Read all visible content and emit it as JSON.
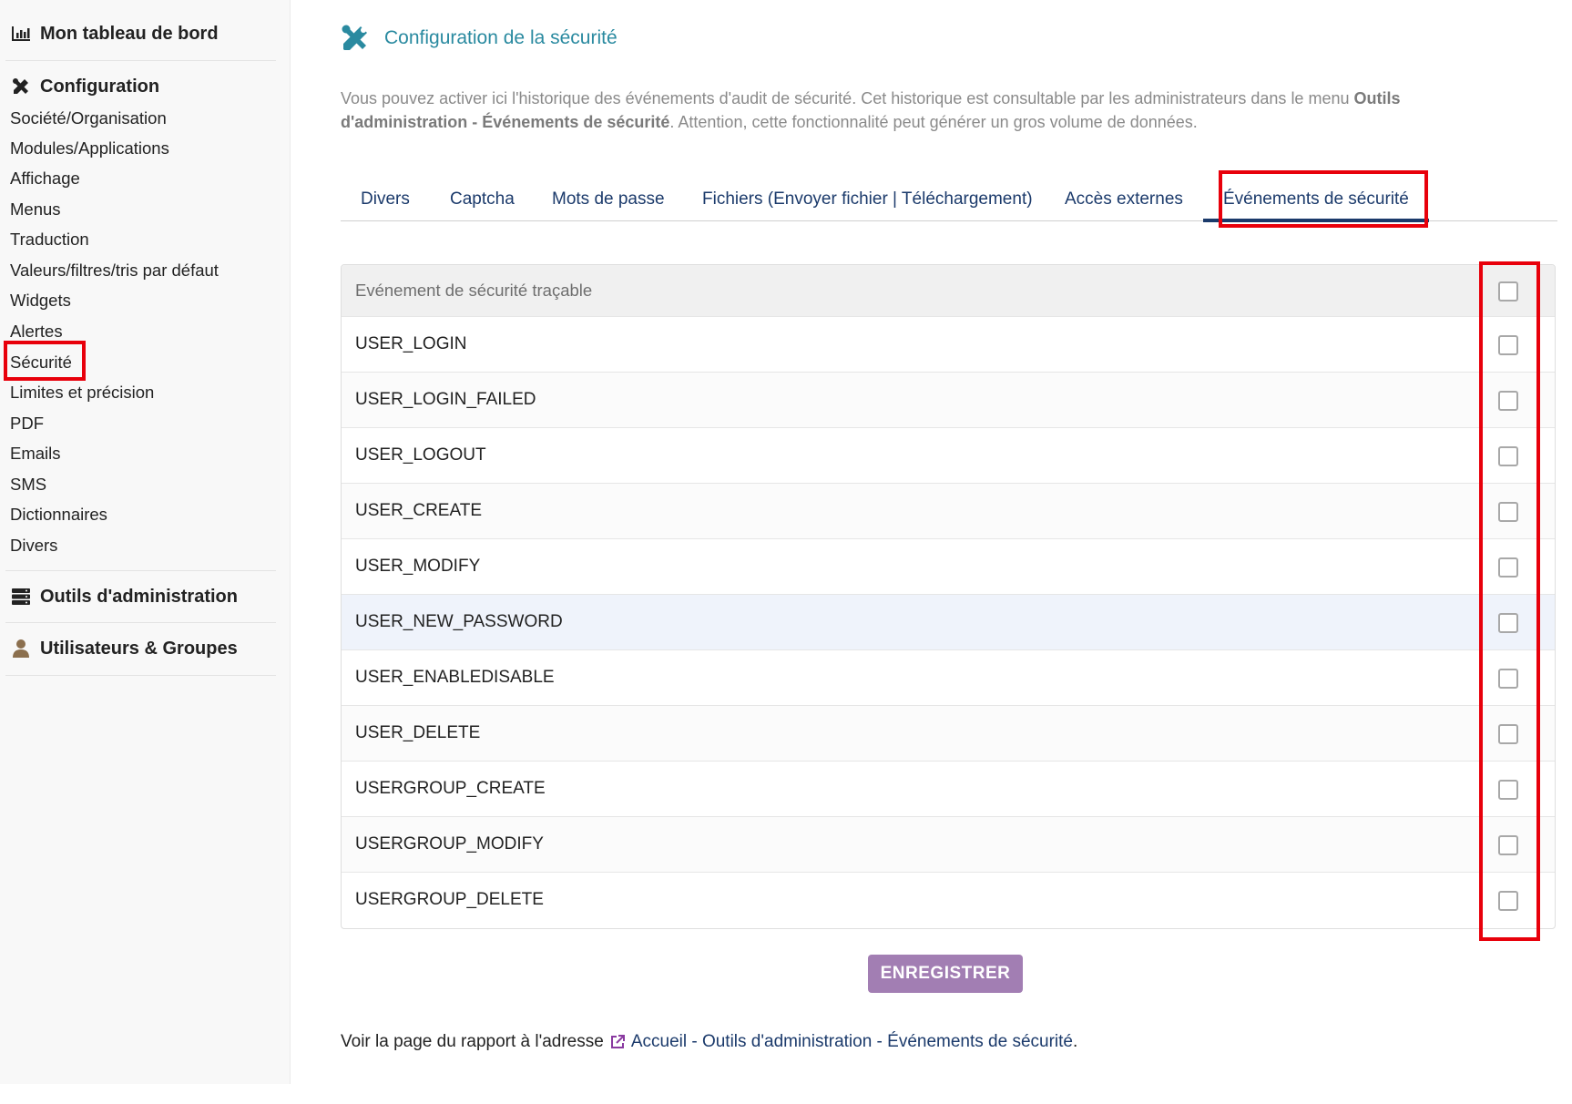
{
  "sidebar": {
    "dashboard_label": "Mon tableau de bord",
    "config_label": "Configuration",
    "items": [
      {
        "label": "Société/Organisation"
      },
      {
        "label": "Modules/Applications"
      },
      {
        "label": "Affichage"
      },
      {
        "label": "Menus"
      },
      {
        "label": "Traduction"
      },
      {
        "label": "Valeurs/filtres/tris par défaut"
      },
      {
        "label": "Widgets"
      },
      {
        "label": "Alertes"
      },
      {
        "label": "Sécurité"
      },
      {
        "label": "Limites et précision"
      },
      {
        "label": "PDF"
      },
      {
        "label": "Emails"
      },
      {
        "label": "SMS"
      },
      {
        "label": "Dictionnaires"
      },
      {
        "label": "Divers"
      }
    ],
    "admin_tools_label": "Outils d'administration",
    "users_groups_label": "Utilisateurs & Groupes",
    "selected_item": "Sécurité"
  },
  "main": {
    "title": "Configuration de la sécurité",
    "description": {
      "part1": "Vous pouvez activer ici l'historique des événements d'audit de sécurité. Cet historique est consultable par les administrateurs dans le menu ",
      "bold": "Outils d'administration - Événements de sécurité",
      "part2": ". Attention, cette fonctionnalité peut générer un gros volume de données."
    },
    "tabs": [
      {
        "label": "Divers"
      },
      {
        "label": "Captcha"
      },
      {
        "label": "Mots de passe"
      },
      {
        "label": "Fichiers (Envoyer fichier | Téléchargement)"
      },
      {
        "label": "Accès externes"
      },
      {
        "label": "Événements de sécurité"
      }
    ],
    "active_tab": "Événements de sécurité",
    "table": {
      "header": "Evénement de sécurité traçable",
      "rows": [
        {
          "event": "USER_LOGIN",
          "checked": false
        },
        {
          "event": "USER_LOGIN_FAILED",
          "checked": false
        },
        {
          "event": "USER_LOGOUT",
          "checked": false
        },
        {
          "event": "USER_CREATE",
          "checked": false
        },
        {
          "event": "USER_MODIFY",
          "checked": false
        },
        {
          "event": "USER_NEW_PASSWORD",
          "checked": false
        },
        {
          "event": "USER_ENABLEDISABLE",
          "checked": false
        },
        {
          "event": "USER_DELETE",
          "checked": false
        },
        {
          "event": "USERGROUP_CREATE",
          "checked": false
        },
        {
          "event": "USERGROUP_MODIFY",
          "checked": false
        },
        {
          "event": "USERGROUP_DELETE",
          "checked": false
        }
      ]
    },
    "save_button": "ENREGISTRER",
    "footer": {
      "prefix": "Voir la page du rapport à l'adresse",
      "link": "Accueil - Outils d'administration - Événements de sécurité",
      "suffix": "."
    }
  },
  "colors": {
    "title": "#2a8aa0",
    "tab_text": "#1b3a6b",
    "highlight": "#e8000b",
    "button": "#a27eb3"
  },
  "icons": {
    "dashboard": "bar-chart-icon",
    "config": "tools-icon",
    "admin_tools": "server-icon",
    "users": "user-icon",
    "title": "tools-icon",
    "external_link": "external-link-icon"
  }
}
